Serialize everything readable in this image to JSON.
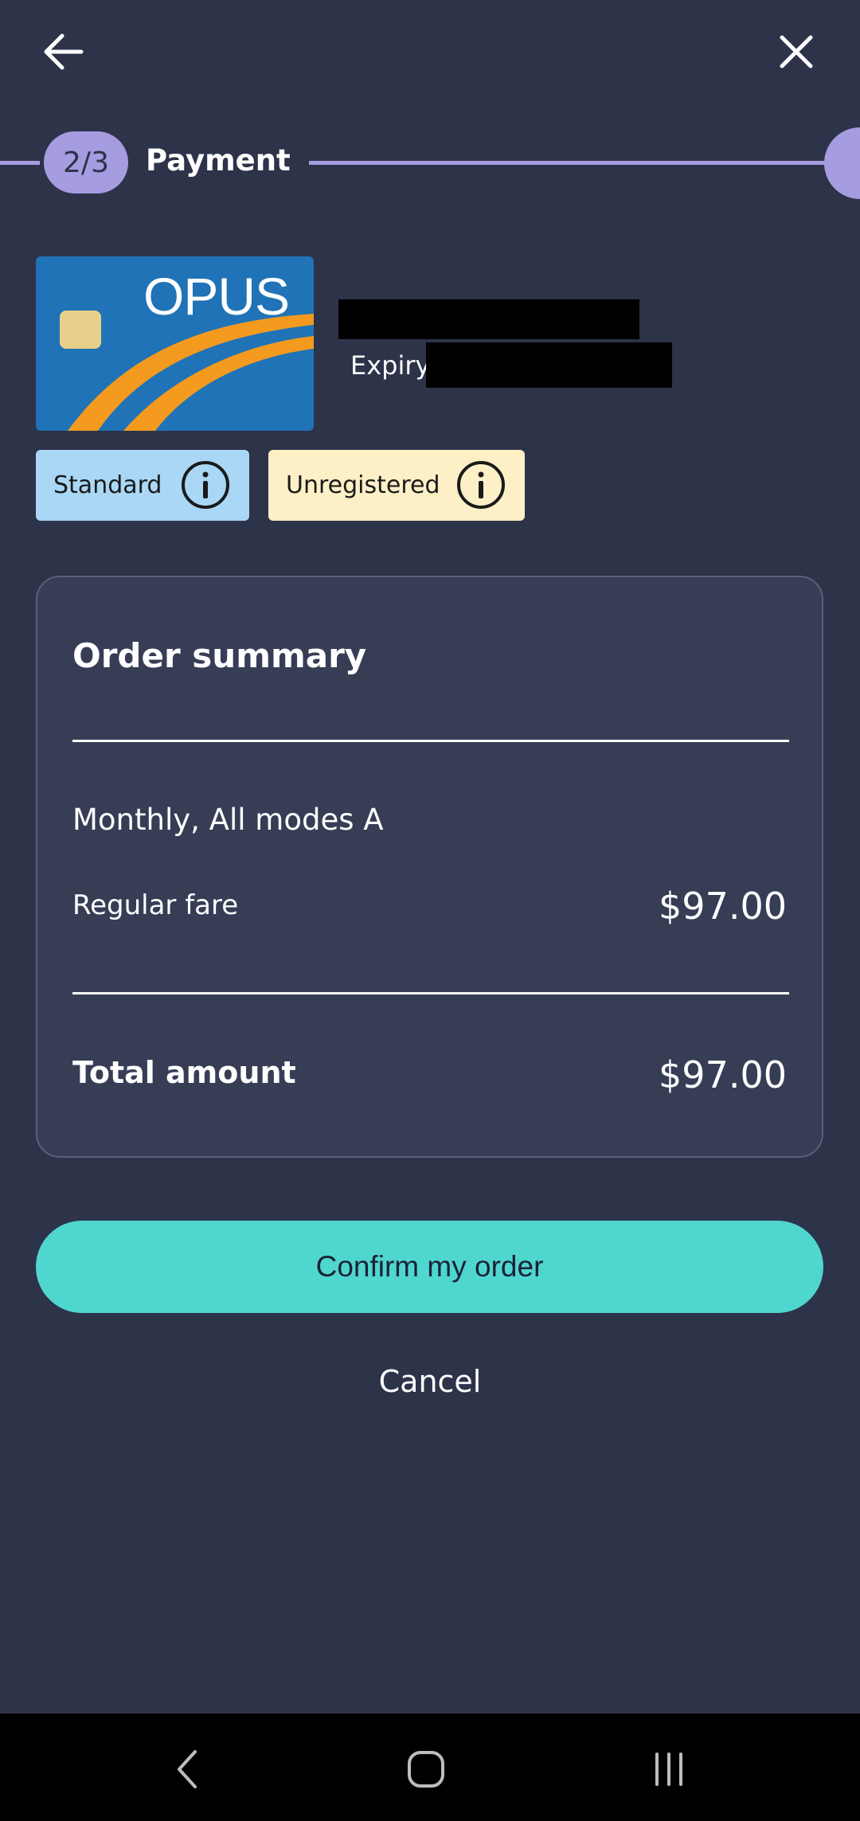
{
  "header": {
    "back_icon": "arrow-left-icon",
    "close_icon": "close-icon"
  },
  "stepper": {
    "step": "2/3",
    "label": "Payment"
  },
  "card": {
    "brand": "OPUS",
    "expiry_label": "Expiry:"
  },
  "badges": {
    "standard": "Standard",
    "unregistered": "Unregistered"
  },
  "summary": {
    "title": "Order summary",
    "product": "Monthly, All modes A",
    "fare_label": "Regular fare",
    "fare_value": "$97.00",
    "total_label": "Total amount",
    "total_value": "$97.00"
  },
  "actions": {
    "confirm": "Confirm my order",
    "cancel": "Cancel"
  },
  "colors": {
    "background": "#2d3349",
    "accent_purple": "#a69ce0",
    "confirm_teal": "#4fd6cf",
    "standard_badge": "#a9d7f5",
    "unregistered_badge": "#fdefc6"
  }
}
